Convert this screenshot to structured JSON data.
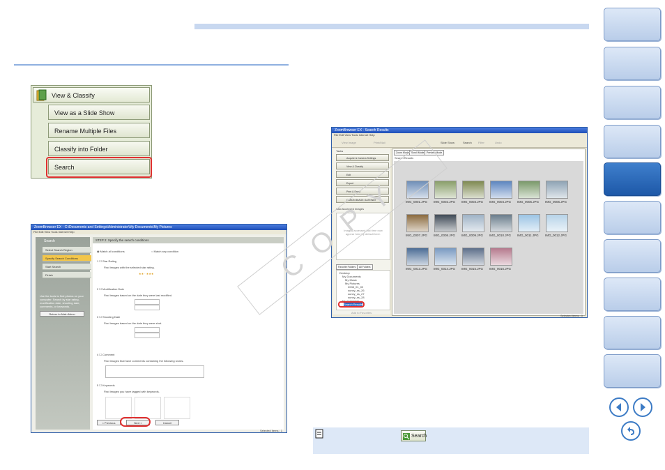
{
  "menu": {
    "items": [
      "View & Classify",
      "View as a Slide Show",
      "Rename Multiple Files",
      "Classify into Folder",
      "Search"
    ]
  },
  "search_window": {
    "title": "ZoomBrowser EX - C:\\Documents and Settings\\Administrator\\My Documents\\My Pictures",
    "menu": "File  Edit  View  Tools  Internet  Help",
    "pane_title": "Search",
    "steps": [
      "Select Search Region",
      "Specify Search Conditions",
      "Start Search",
      "Finish"
    ],
    "left_text": "Use the tools to find photos on your computer. Search by star rating, modification date, shooting date, comments, or keywords.",
    "return_label": "Return to Main Menu",
    "header": "STEP 2: Specify the search conditions",
    "match_all": "Match all conditions",
    "match_any": "Match any condition",
    "sections": [
      {
        "num": "1",
        "title": "Star Rating",
        "desc": "Find images with the selected star rating."
      },
      {
        "num": "2",
        "title": "Modification Date",
        "desc": "Find images based on the date they were last modified."
      },
      {
        "num": "3",
        "title": "Shooting Date",
        "desc": "Find images based on the date they were shot."
      },
      {
        "num": "4",
        "title": "Comment",
        "desc": "Find images that have comments containing the following words."
      },
      {
        "num": "5",
        "title": "Keywords",
        "desc": "Find images you have tagged with keywords."
      }
    ],
    "buttons": {
      "previous": "< Previous",
      "next": "Next >",
      "cancel": "Cancel"
    },
    "status": "Selected Items : 1"
  },
  "results_window": {
    "title": "ZoomBrowser EX - Search Results",
    "menu": "File  Edit  View  Tools  Internet  Help",
    "toolbar": [
      "View Image",
      "Print/Mail",
      "Slide Show",
      "Search",
      "Filter",
      "Undo"
    ],
    "tasks_title": "Tasks",
    "tasks": [
      "Acquire & Camera Settings",
      "View & Classify",
      "Edit",
      "Export",
      "Print & Email",
      "CANON iMAGE GATEWAY"
    ],
    "last_accessed": "Last Accessed Images",
    "last_accessed_hint": "Images accessed last time now appear here by default here.",
    "folder_tabs": [
      "Favorite Folders",
      "All Folders"
    ],
    "tree": [
      "Desktop",
      "My Documents",
      "My Music",
      "My Pictures",
      "2008_01_02",
      "sunny_ss_26",
      "sunny_ss_27",
      "sunny_ss_28",
      "My Computer",
      "Search Results"
    ],
    "add_favorites": "Add to Favorites",
    "view_tabs": [
      "Zoom Mode",
      "Scroll Mode",
      "Preview Mode"
    ],
    "results_label": "Search Results",
    "files": [
      {
        "name": "IMG_0001.JPG",
        "color": "#6f8fb8"
      },
      {
        "name": "IMG_0002.JPG",
        "color": "#8a9f6a"
      },
      {
        "name": "IMG_0003.JPG",
        "color": "#7f8a52"
      },
      {
        "name": "IMG_0004.JPG",
        "color": "#5d86c0"
      },
      {
        "name": "IMG_0005.JPG",
        "color": "#7a9a6a"
      },
      {
        "name": "IMG_0006.JPG",
        "color": "#8fa4b5"
      },
      {
        "name": "IMG_0007.JPG",
        "color": "#8b6a3e"
      },
      {
        "name": "IMG_0008.JPG",
        "color": "#3f4a56"
      },
      {
        "name": "IMG_0009.JPG",
        "color": "#9fb3c6"
      },
      {
        "name": "IMG_0010.JPG",
        "color": "#6a7d8c"
      },
      {
        "name": "IMG_0011.JPG",
        "color": "#9cc4e4"
      },
      {
        "name": "IMG_0012.JPG",
        "color": "#b7d3e8"
      },
      {
        "name": "IMG_0013.JPG",
        "color": "#4c6d96"
      },
      {
        "name": "IMG_0014.JPG",
        "color": "#7a9bc2"
      },
      {
        "name": "IMG_0015.JPG",
        "color": "#5d6f8a"
      },
      {
        "name": "IMG_0016.JPG",
        "color": "#b67a8e"
      }
    ],
    "status": "Selected Items : 0"
  },
  "watermark": "COPY",
  "note": {
    "button_label": "Search"
  }
}
